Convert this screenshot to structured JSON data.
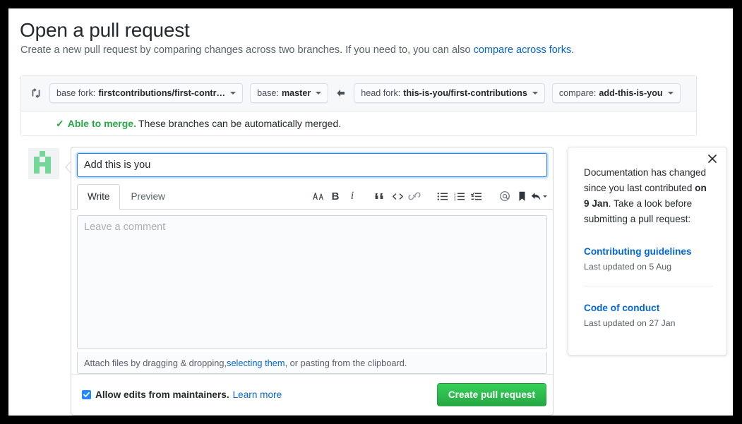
{
  "header": {
    "title": "Open a pull request",
    "subtitle_part1": "Create a new pull request by comparing changes across two branches. If you need to, you can also ",
    "subtitle_link": "compare across forks",
    "subtitle_part2": "."
  },
  "branch_bar": {
    "compare_icon": "compare-icon",
    "arrow_icon": "arrow-left-icon",
    "base_fork": {
      "label": "base fork:",
      "value": "firstcontributions/first-contr…"
    },
    "base": {
      "label": "base:",
      "value": "master"
    },
    "head_fork": {
      "label": "head fork:",
      "value": "this-is-you/first-contributions"
    },
    "compare": {
      "label": "compare:",
      "value": "add-this-is-you"
    },
    "merge_status": {
      "check": "✓",
      "strong": "Able to merge.",
      "rest": "These branches can be automatically merged.",
      "color": "#28a745"
    }
  },
  "composer": {
    "avatar_alt": "user-avatar",
    "title_value": "Add this is you",
    "title_placeholder": "Title",
    "tabs": [
      {
        "label": "Write",
        "active": true
      },
      {
        "label": "Preview",
        "active": false
      }
    ],
    "toolbar": [
      {
        "name": "heading-icon",
        "glyph": "AA"
      },
      {
        "name": "bold-icon",
        "glyph": "B"
      },
      {
        "name": "italic-icon",
        "glyph": "i"
      },
      {
        "name": "quote-icon",
        "glyph": "“"
      },
      {
        "name": "code-icon",
        "glyph": "<>"
      },
      {
        "name": "link-icon",
        "glyph": "link"
      },
      {
        "name": "unordered-list-icon",
        "glyph": "list"
      },
      {
        "name": "ordered-list-icon",
        "glyph": "numlist"
      },
      {
        "name": "task-list-icon",
        "glyph": "tasklist"
      },
      {
        "name": "mention-icon",
        "glyph": "@"
      },
      {
        "name": "saved-reply-icon",
        "glyph": "bookmark"
      },
      {
        "name": "reply-icon",
        "glyph": "reply"
      }
    ],
    "comment_placeholder": "Leave a comment",
    "comment_value": "",
    "attach": {
      "part1": "Attach files by dragging & dropping, ",
      "link": "selecting them",
      "part2": ", or pasting from the clipboard."
    },
    "allow_edits": {
      "checked": true,
      "label": "Allow edits from maintainers.",
      "link": "Learn more"
    },
    "submit_label": "Create pull request",
    "submit_color": "#2ebc4f"
  },
  "docs_panel": {
    "close_icon": "close-icon",
    "intro_part1": "Documentation has changed since you last contributed ",
    "intro_bold": "on 9 Jan",
    "intro_part2": ". Take a look before submitting a pull request:",
    "items": [
      {
        "link": "Contributing guidelines",
        "meta": "Last updated on 5 Aug"
      },
      {
        "link": "Code of conduct",
        "meta": "Last updated on 27 Jan"
      }
    ],
    "link_color": "#0366d6"
  }
}
